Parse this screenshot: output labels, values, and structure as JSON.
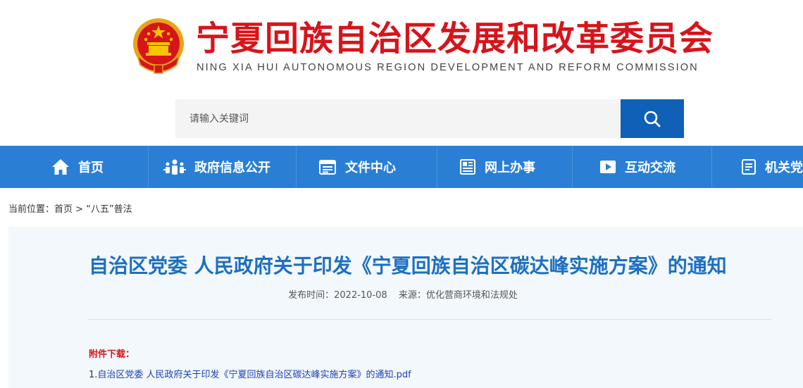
{
  "header": {
    "title": "宁夏回族自治区发展和改革委员会",
    "subtitle": "NING XIA HUI AUTONOMOUS REGION DEVELOPMENT AND REFORM COMMISSION"
  },
  "search": {
    "placeholder": "请输入关键词"
  },
  "nav": {
    "items": [
      {
        "label": "首页",
        "icon": "home-icon"
      },
      {
        "label": "政府信息公开",
        "icon": "people-info-icon"
      },
      {
        "label": "文件中心",
        "icon": "document-icon"
      },
      {
        "label": "网上办事",
        "icon": "newspaper-icon"
      },
      {
        "label": "互动交流",
        "icon": "play-icon"
      },
      {
        "label": "机关党",
        "icon": "list-doc-icon"
      }
    ]
  },
  "breadcrumb": {
    "prefix": "当前位置：",
    "home": "首页",
    "separator": " > ",
    "current": "“八五”普法"
  },
  "article": {
    "title": "自治区党委 人民政府关于印发《宁夏回族自治区碳达峰实施方案》的通知",
    "date_label": "发布时间：",
    "date": "2022-10-08",
    "source_label": "来源：",
    "source": "优化营商环境和法规处",
    "attachments_label": "附件下载：",
    "attachments": [
      {
        "index": "1.",
        "name": "自治区党委 人民政府关于印发《宁夏回族自治区碳达峰实施方案》的通知.pdf"
      }
    ]
  },
  "colors": {
    "brand_red": "#d7141a",
    "nav_blue": "#2a7fd4",
    "title_blue": "#1e6fc1",
    "link_blue": "#1a3fb8"
  }
}
